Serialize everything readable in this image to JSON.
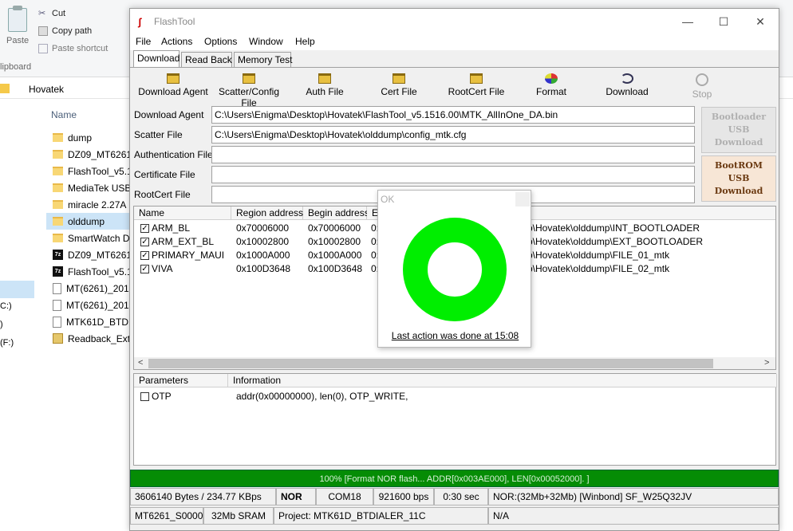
{
  "explorer": {
    "ribbon": {
      "paste_label": "Paste",
      "cut_label": "Cut",
      "copy_path_label": "Copy path",
      "paste_shortcut_label": "Paste shortcut",
      "group_label": "lipboard"
    },
    "address": "Hovatek",
    "column_name": "Name",
    "nav_drives": [
      "C:)",
      ")",
      "(F:)"
    ],
    "files": [
      {
        "name": "dump",
        "icon": "folder-icon"
      },
      {
        "name": "DZ09_MT6261_",
        "icon": "folder-icon"
      },
      {
        "name": "FlashTool_v5.1!",
        "icon": "folder-icon"
      },
      {
        "name": "MediaTek USB",
        "icon": "folder-icon"
      },
      {
        "name": "miracle 2.27A",
        "icon": "folder-icon"
      },
      {
        "name": "olddump",
        "icon": "folder-icon"
      },
      {
        "name": "SmartWatch D:",
        "icon": "folder-icon"
      },
      {
        "name": "DZ09_MT6261_",
        "icon": "7z-icon"
      },
      {
        "name": "FlashTool_v5.1:",
        "icon": "7z-icon"
      },
      {
        "name": "MT(6261)_2017",
        "icon": "document-icon"
      },
      {
        "name": "MT(6261)_2017",
        "icon": "document-icon"
      },
      {
        "name": "MTK61D_BTDIAI",
        "icon": "document-icon"
      },
      {
        "name": "Readback_Extra",
        "icon": "archive-icon"
      }
    ]
  },
  "flashtool": {
    "title": "FlashTool",
    "menu": [
      "File",
      "Actions",
      "Options",
      "Window",
      "Help"
    ],
    "tabs": [
      "Download",
      "Read Back",
      "Memory Test"
    ],
    "toolbar": {
      "download_agent": "Download Agent",
      "scatter_config": "Scatter/Config File",
      "auth_file": "Auth File",
      "cert_file": "Cert File",
      "rootcert_file": "RootCert File",
      "format": "Format",
      "download": "Download",
      "stop": "Stop"
    },
    "fields": {
      "download_agent_label": "Download Agent",
      "download_agent_value": "C:\\Users\\Enigma\\Desktop\\Hovatek\\FlashTool_v5.1516.00\\MTK_AllInOne_DA.bin",
      "scatter_label": "Scatter File",
      "scatter_value": "C:\\Users\\Enigma\\Desktop\\Hovatek\\olddump\\config_mtk.cfg",
      "auth_label": "Authentication File",
      "auth_value": "",
      "cert_label": "Certificate File",
      "cert_value": "",
      "rootcert_label": "RootCert File",
      "rootcert_value": ""
    },
    "side_buttons": {
      "bootloader": [
        "Bootloader",
        "USB",
        "Download"
      ],
      "bootrom": [
        "BootROM",
        "USB",
        "Download"
      ]
    },
    "table": {
      "headers": [
        "Name",
        "Region address",
        "Begin address",
        "E"
      ],
      "rows": [
        {
          "name": "ARM_BL",
          "region": "0x70006000",
          "begin": "0x70006000",
          "e": "0:",
          "path": "p\\Hovatek\\olddump\\INT_BOOTLOADER",
          "checked": "✓"
        },
        {
          "name": "ARM_EXT_BL",
          "region": "0x10002800",
          "begin": "0x10002800",
          "e": "0:",
          "path": "p\\Hovatek\\olddump\\EXT_BOOTLOADER",
          "checked": "✓"
        },
        {
          "name": "PRIMARY_MAUI",
          "region": "0x1000A000",
          "begin": "0x1000A000",
          "e": "0:",
          "path": "p\\Hovatek\\olddump\\FILE_01_mtk",
          "checked": "✓"
        },
        {
          "name": "VIVA",
          "region": "0x100D3648",
          "begin": "0x100D3648",
          "e": "0:",
          "path": "p\\Hovatek\\olddump\\FILE_02_mtk",
          "checked": "✓"
        }
      ]
    },
    "params": {
      "headers": [
        "Parameters",
        "Information"
      ],
      "rows": [
        {
          "name": "OTP",
          "info": "addr(0x00000000), len(0), OTP_WRITE,"
        }
      ]
    },
    "progress": {
      "percent": 100,
      "text": "100% [Format NOR flash... ADDR[0x003AE000], LEN[0x00052000]. ]"
    },
    "status": {
      "bytes": "3606140 Bytes / 234.77 KBps",
      "flash_type": "NOR",
      "port": "COM18",
      "baud": "921600 bps",
      "time": "0:30 sec",
      "flash_info": "NOR:(32Mb+32Mb) [Winbond] SF_W25Q32JV",
      "chip": "MT6261_S0000",
      "sram": "32Mb SRAM",
      "project": "Project: MTK61D_BTDIALER_11C",
      "extra": "N/A"
    }
  },
  "dialog": {
    "title": "OK",
    "message": "Last action was done at 15:08",
    "ring_color": "#00ee00"
  }
}
